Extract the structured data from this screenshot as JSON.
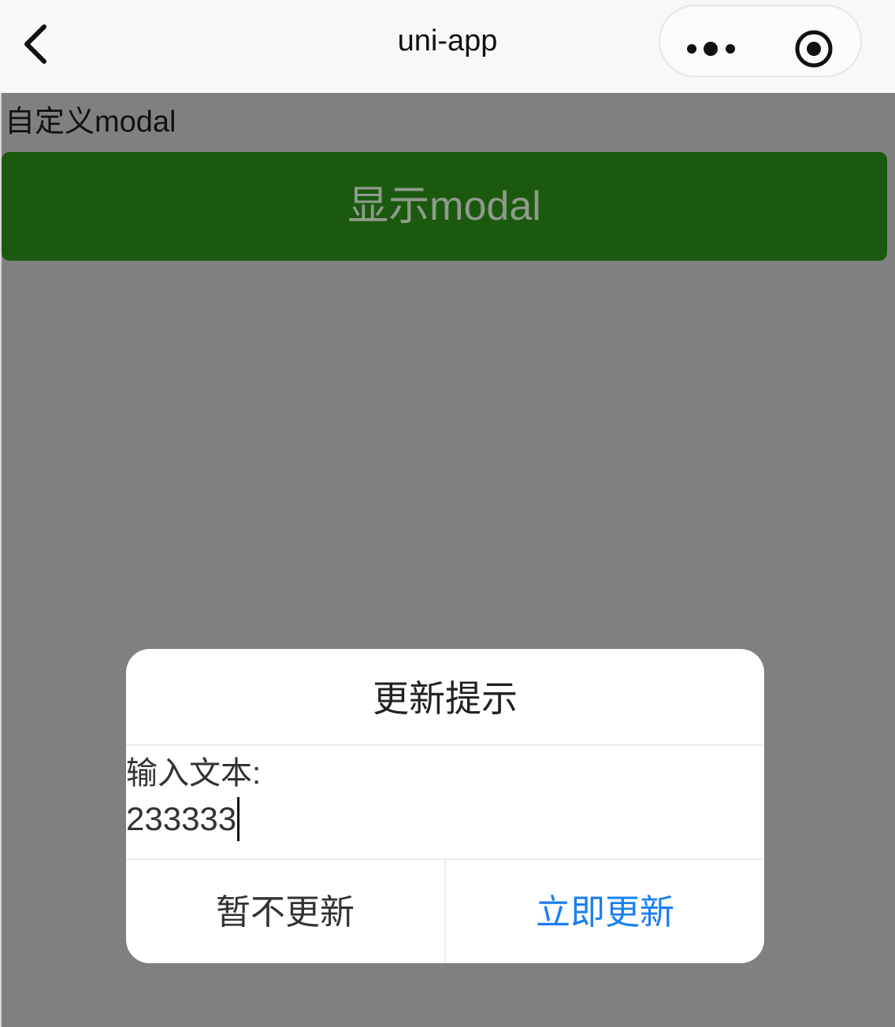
{
  "navbar": {
    "title": "uni-app",
    "back_icon": "chevron-left-icon",
    "more_icon": "more-dots-icon",
    "close_icon": "target-close-icon"
  },
  "page": {
    "section_label": "自定义modal",
    "show_modal_button": "显示modal",
    "button_color": "#1b5a0e",
    "overlay_color": "#808080"
  },
  "modal": {
    "title": "更新提示",
    "input_label": "输入文本:",
    "input_value": "233333",
    "cancel_label": "暂不更新",
    "confirm_label": "立即更新",
    "confirm_color": "#1a7ff0"
  }
}
